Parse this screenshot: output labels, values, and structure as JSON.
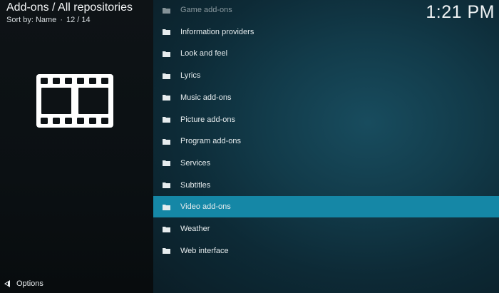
{
  "header": {
    "title": "Add-ons / All repositories",
    "sort_label": "Sort by: Name",
    "separator": "·",
    "position": "12 / 14"
  },
  "clock": "1:21 PM",
  "preview_icon": "film-strip-icon",
  "options": {
    "label": "Options",
    "icon": "options-arrow-icon"
  },
  "list": {
    "items": [
      {
        "label": "Game add-ons",
        "icon": "folder-icon",
        "selected": false
      },
      {
        "label": "Information providers",
        "icon": "folder-icon",
        "selected": false
      },
      {
        "label": "Look and feel",
        "icon": "folder-icon",
        "selected": false
      },
      {
        "label": "Lyrics",
        "icon": "folder-icon",
        "selected": false
      },
      {
        "label": "Music add-ons",
        "icon": "folder-icon",
        "selected": false
      },
      {
        "label": "Picture add-ons",
        "icon": "folder-icon",
        "selected": false
      },
      {
        "label": "Program add-ons",
        "icon": "folder-icon",
        "selected": false
      },
      {
        "label": "Services",
        "icon": "folder-icon",
        "selected": false
      },
      {
        "label": "Subtitles",
        "icon": "folder-icon",
        "selected": false
      },
      {
        "label": "Video add-ons",
        "icon": "folder-icon",
        "selected": true
      },
      {
        "label": "Weather",
        "icon": "folder-icon",
        "selected": false
      },
      {
        "label": "Web interface",
        "icon": "folder-icon",
        "selected": false
      }
    ]
  },
  "colors": {
    "selection": "#1587a6",
    "list_background": "#123b4a",
    "left_background": "#0e1316"
  }
}
